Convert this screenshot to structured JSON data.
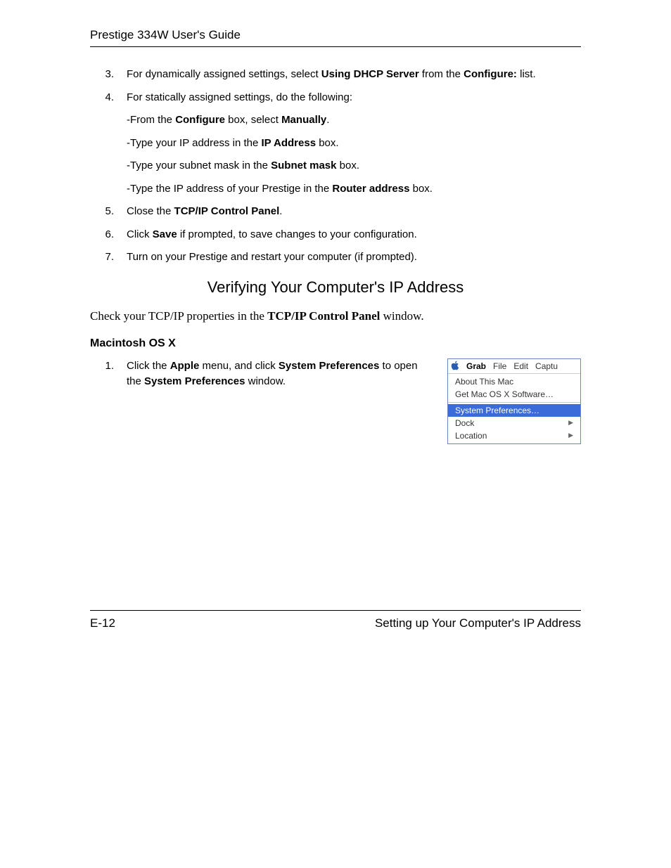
{
  "header": {
    "title": "Prestige 334W User's Guide"
  },
  "steps": {
    "s3": {
      "num": "3.",
      "pre": "For dynamically assigned settings, select ",
      "b1": "Using DHCP Server",
      "mid": " from the ",
      "b2": "Configure:",
      "post": " list."
    },
    "s4": {
      "num": "4.",
      "text": "For statically assigned settings, do the following:"
    },
    "s4a": {
      "pre": "-From the ",
      "b1": "Configure",
      "mid": " box, select ",
      "b2": "Manually",
      "post": "."
    },
    "s4b": {
      "pre": "-Type your IP address in the ",
      "b1": "IP Address",
      "post": " box."
    },
    "s4c": {
      "pre": "-Type your subnet mask in the ",
      "b1": "Subnet mask",
      "post": " box."
    },
    "s4d": {
      "pre": "-Type the IP address of your Prestige in the ",
      "b1": "Router address",
      "post": " box."
    },
    "s5": {
      "num": "5.",
      "pre": "Close the ",
      "b1": "TCP/IP Control Panel",
      "post": "."
    },
    "s6": {
      "num": "6.",
      "pre": "Click ",
      "b1": "Save",
      "post": " if prompted, to save changes to your configuration."
    },
    "s7": {
      "num": "7.",
      "text": "Turn on your Prestige and restart your computer (if prompted)."
    }
  },
  "section_heading": "Verifying Your Computer's IP Address",
  "serif_line": {
    "pre": "Check your TCP/IP properties in the ",
    "b1": "TCP/IP Control Panel",
    "post": " window."
  },
  "subhead": "Macintosh OS X",
  "osx_step1": {
    "num": "1.",
    "pre": "Click the ",
    "b1": "Apple",
    "mid1": " menu, and click ",
    "b2": "System Preferences",
    "mid2": " to open the ",
    "b3": "System Preferences",
    "post": " window."
  },
  "apple_menu": {
    "logo": "",
    "menubar": [
      "Grab",
      "File",
      "Edit",
      "Captu"
    ],
    "items": {
      "about": "About This Mac",
      "getsw": "Get Mac OS X Software…",
      "sysprefs": "System Preferences…",
      "dock": "Dock",
      "location": "Location",
      "arrow": "▶"
    }
  },
  "footer": {
    "left": "E-12",
    "right": "Setting up Your Computer's IP Address"
  }
}
